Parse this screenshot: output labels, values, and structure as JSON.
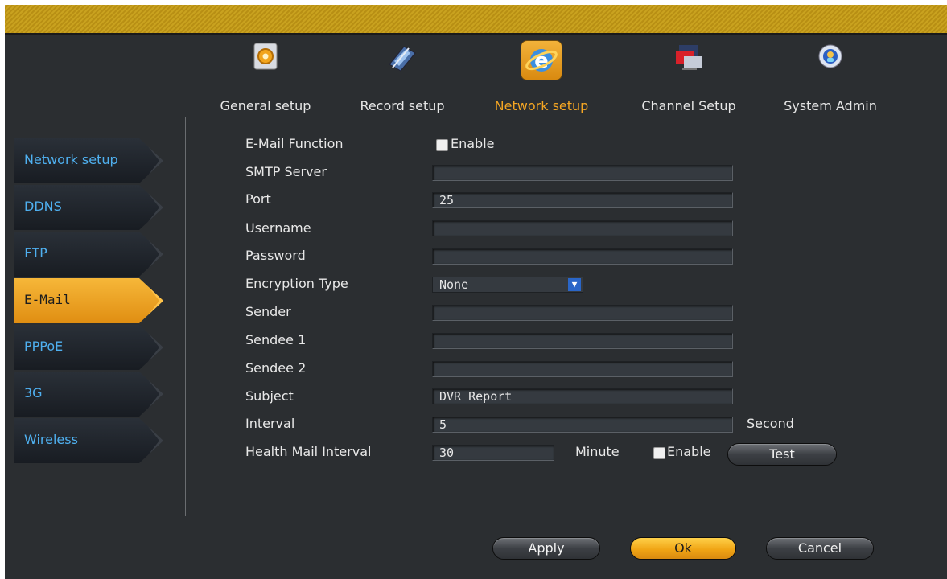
{
  "topnav": [
    {
      "label": "General setup",
      "icon": "gear-icon"
    },
    {
      "label": "Record setup",
      "icon": "record-icon"
    },
    {
      "label": "Network setup",
      "icon": "network-globe-icon",
      "active": true
    },
    {
      "label": "Channel Setup",
      "icon": "channel-icon"
    },
    {
      "label": "System Admin",
      "icon": "system-admin-icon"
    }
  ],
  "sidebar": [
    {
      "label": "Network setup"
    },
    {
      "label": "DDNS"
    },
    {
      "label": "FTP"
    },
    {
      "label": "E-Mail",
      "active": true
    },
    {
      "label": "PPPoE"
    },
    {
      "label": "3G"
    },
    {
      "label": "Wireless"
    }
  ],
  "form": {
    "email_function_label": "E-Mail Function",
    "email_enable_label": "Enable",
    "email_enable_checked": false,
    "smtp_server_label": "SMTP Server",
    "smtp_server_value": "",
    "port_label": "Port",
    "port_value": "25",
    "username_label": "Username",
    "username_value": "",
    "password_label": "Password",
    "password_value": "",
    "encryption_label": "Encryption Type",
    "encryption_value": "None",
    "sender_label": "Sender",
    "sender_value": "",
    "sendee1_label": "Sendee 1",
    "sendee1_value": "",
    "sendee2_label": "Sendee 2",
    "sendee2_value": "",
    "subject_label": "Subject",
    "subject_value": "DVR Report",
    "interval_label": "Interval",
    "interval_value": "5",
    "interval_unit": "Second",
    "health_label": "Health Mail Interval",
    "health_value": "30",
    "health_unit": "Minute",
    "health_enable_label": "Enable",
    "health_enable_checked": false,
    "test_label": "Test"
  },
  "buttons": {
    "apply": "Apply",
    "ok": "Ok",
    "cancel": "Cancel"
  },
  "colors": {
    "accent": "#f5a623",
    "title_bar": "#c9a21f",
    "background": "#2b2e31",
    "sidebar_text": "#4fb0f0"
  }
}
